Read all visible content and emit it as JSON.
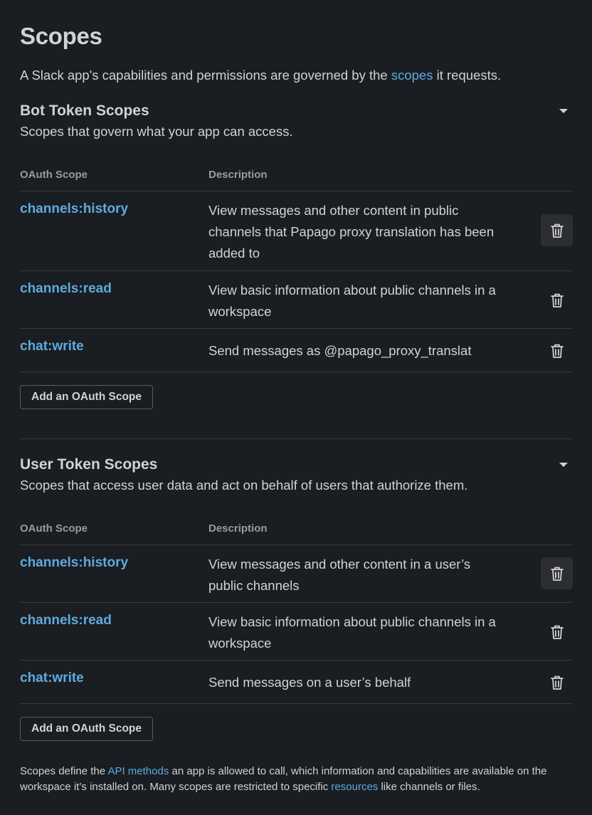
{
  "page": {
    "title": "Scopes",
    "intro_before": "A Slack app's capabilities and permissions are governed by the ",
    "intro_link": "scopes",
    "intro_after": " it requests."
  },
  "columns": {
    "scope": "OAuth Scope",
    "description": "Description"
  },
  "bot": {
    "title": "Bot Token Scopes",
    "subtitle": "Scopes that govern what your app can access.",
    "add_label": "Add an OAuth Scope",
    "rows": [
      {
        "scope": "channels:history",
        "description": "View messages and other content in public channels that Papago proxy translation has been added to"
      },
      {
        "scope": "channels:read",
        "description": "View basic information about public channels in a workspace"
      },
      {
        "scope": "chat:write",
        "description": "Send messages as @papago_proxy_translat"
      }
    ]
  },
  "user": {
    "title": "User Token Scopes",
    "subtitle": "Scopes that access user data and act on behalf of users that authorize them.",
    "add_label": "Add an OAuth Scope",
    "rows": [
      {
        "scope": "channels:history",
        "description": "View messages and other content in a user’s public channels"
      },
      {
        "scope": "channels:read",
        "description": "View basic information about public channels in a workspace"
      },
      {
        "scope": "chat:write",
        "description": "Send messages on a user’s behalf"
      }
    ]
  },
  "footer": {
    "t1": "Scopes define the ",
    "link1": "API methods",
    "t2": " an app is allowed to call, which information and capabilities are available on the workspace it’s installed on. Many scopes are restricted to specific ",
    "link2": "resources",
    "t3": " like channels or files."
  },
  "colors": {
    "background": "#1a1d21",
    "link": "#5eaae0",
    "text": "#d1d2d3"
  },
  "icons": {
    "collapse": "caret-down-icon",
    "remove": "trash-icon"
  }
}
